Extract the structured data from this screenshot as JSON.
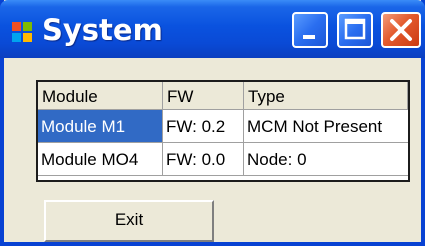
{
  "window": {
    "title": "System",
    "controls": {
      "minimize_icon": "minimize-icon",
      "maximize_icon": "maximize-icon",
      "close_icon": "close-icon"
    },
    "app_icon": "windows-flag-icon"
  },
  "grid": {
    "columns": [
      "Module",
      "FW",
      "Type"
    ],
    "rows": [
      [
        "Module M1",
        "FW: 0.2",
        "MCM Not Present"
      ],
      [
        "Module MO4",
        "FW: 0.0",
        "Node: 0"
      ]
    ],
    "selected_cell": "Module M1"
  },
  "buttons": {
    "exit_label": "Exit"
  },
  "colors": {
    "titlebar": "#0a52df",
    "close_button": "#e35a2d",
    "selection": "#316ac5",
    "window_body": "#ece9d8"
  }
}
